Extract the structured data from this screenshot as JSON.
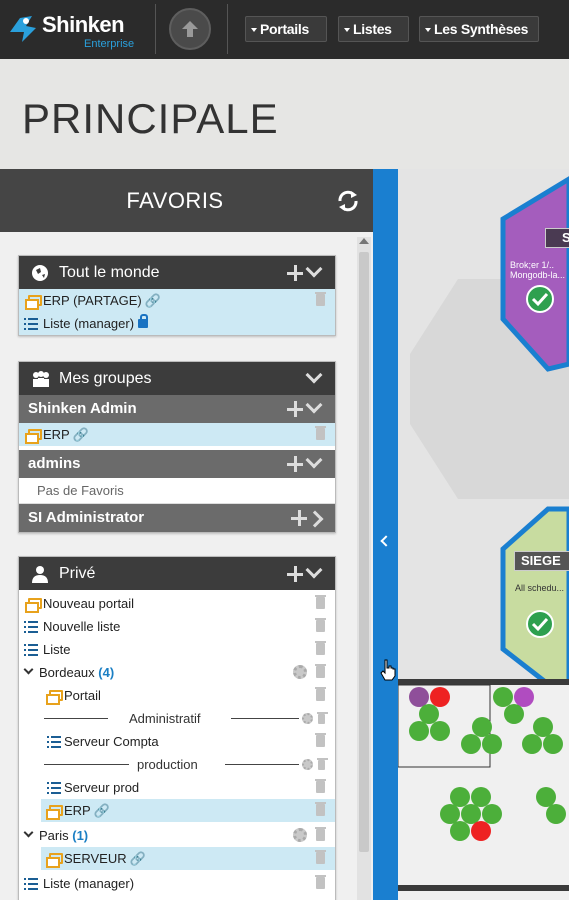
{
  "app": {
    "logo_name": "Shinken",
    "logo_sub": "Enterprise"
  },
  "nav": {
    "menus": [
      "Portails",
      "Listes",
      "Les Synthèses"
    ]
  },
  "page_title": "PRINCIPALE",
  "favoris": {
    "title": "FAVORIS",
    "tout_le_monde": {
      "title": "Tout le monde",
      "items": [
        {
          "label": "ERP (PARTAGE)",
          "type": "portal",
          "linked": true
        },
        {
          "label": "Liste (manager)",
          "type": "list",
          "locked": true
        }
      ]
    },
    "mes_groupes": {
      "title": "Mes groupes",
      "groups": [
        {
          "name": "Shinken Admin",
          "items": [
            {
              "label": "ERP",
              "type": "portal",
              "linked": true
            }
          ]
        },
        {
          "name": "admins",
          "empty_text": "Pas de Favoris"
        },
        {
          "name": "SI Administrator"
        }
      ]
    },
    "prive": {
      "title": "Privé",
      "items": [
        {
          "label": "Nouveau portail",
          "type": "portal"
        },
        {
          "label": "Nouvelle liste",
          "type": "list"
        },
        {
          "label": "Liste",
          "type": "list"
        }
      ],
      "bordeaux": {
        "name": "Bordeaux",
        "count": "(4)",
        "portal": "Portail",
        "sep1": "Administratif",
        "compta": "Serveur Compta",
        "sep2": "production",
        "prod": "Serveur prod",
        "erp": "ERP"
      },
      "paris": {
        "name": "Paris",
        "count": "(1)",
        "serveur": "SERVEUR"
      },
      "last": "Liste (manager)"
    }
  },
  "dashboard": {
    "tile1_label": "S",
    "tile1_text1": "Brok;er 1/..",
    "tile1_text2": "Mongodb-la...",
    "tile2_label": "SIEGE",
    "tile2_text": "All schedu..."
  },
  "colors": {
    "accent": "#1a7fd0",
    "ok": "#2ea04f",
    "critical": "#e22",
    "warning_purple": "#b04cc0"
  }
}
